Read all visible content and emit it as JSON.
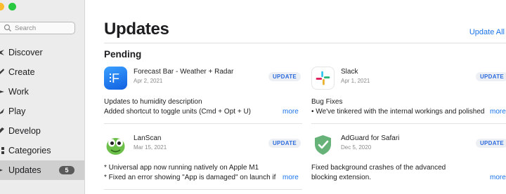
{
  "sidebar": {
    "search_placeholder": "Search",
    "items": [
      {
        "label": "Discover",
        "icon": "star-icon"
      },
      {
        "label": "Create",
        "icon": "brush-icon"
      },
      {
        "label": "Work",
        "icon": "paperplane-icon"
      },
      {
        "label": "Play",
        "icon": "rocket-icon"
      },
      {
        "label": "Develop",
        "icon": "hammer-icon"
      },
      {
        "label": "Categories",
        "icon": "grid-icon"
      },
      {
        "label": "Updates",
        "icon": "download-icon",
        "badge": "5",
        "active": true
      }
    ]
  },
  "main": {
    "title": "Updates",
    "update_all": "Update All",
    "section": "Pending",
    "update_label": "UPDATE",
    "more_label": "more",
    "apps": [
      {
        "name": "Forecast Bar - Weather + Radar",
        "date": "Apr 2, 2021",
        "note1": "Updates to humidity description",
        "note2": "Added shortcut to toggle units (Cmd + Opt + U)"
      },
      {
        "name": "Slack",
        "date": "Apr 1, 2021",
        "note1": "Bug Fixes",
        "note2": "• We've tinkered with the internal workings and polished"
      },
      {
        "name": "LanScan",
        "date": "Mar 15, 2021",
        "note1": "* Universal app now running natively on Apple M1",
        "note2": "* Fixed an error showing \"App is damaged\" on launch if"
      },
      {
        "name": "AdGuard for Safari",
        "date": "Dec 5, 2020",
        "note1": "Fixed background crashes of the advanced",
        "note2": "blocking extension."
      }
    ]
  },
  "colors": {
    "accent": "#1a73e8",
    "button_bg": "#eceff3"
  }
}
